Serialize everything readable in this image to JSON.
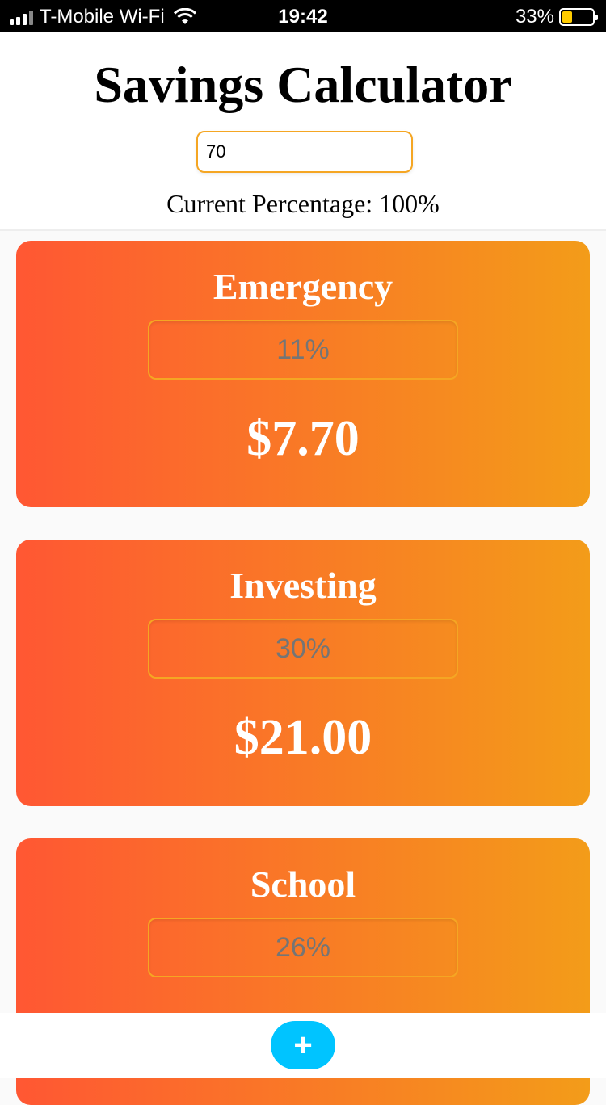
{
  "status_bar": {
    "carrier": "T-Mobile Wi-Fi",
    "time": "19:42",
    "battery": "33%",
    "battery_level": 0.33,
    "icons": [
      "signal-icon",
      "wifi-icon",
      "battery-icon"
    ]
  },
  "header": {
    "title": "Savings Calculator",
    "amount_value": "70",
    "current_percentage": "Current Percentage: 100%"
  },
  "cards": [
    {
      "name": "Emergency",
      "percent": "11%",
      "amount": "$7.70"
    },
    {
      "name": "Investing",
      "percent": "30%",
      "amount": "$21.00"
    },
    {
      "name": "School",
      "percent": "26%",
      "amount": ""
    }
  ],
  "bottom_bar": {
    "add_label": "+"
  },
  "colors": {
    "card_gradient_start": "#ff5733",
    "card_gradient_end": "#f39c19",
    "input_border": "#f5a623",
    "add_button": "#00c4ff",
    "battery_fill": "#ffcc00"
  }
}
